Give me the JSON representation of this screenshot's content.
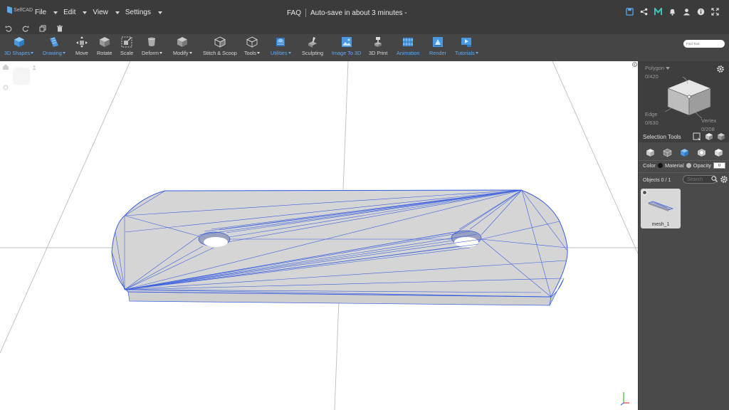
{
  "topbar": {
    "logo_text": "SelfCAD",
    "menu": [
      "File",
      "Edit",
      "View",
      "Settings"
    ],
    "faq": "FAQ",
    "autosave": "Auto-save in about 3 minutes -",
    "icons": [
      "save-icon",
      "share-icon",
      "m-icon",
      "bell-icon",
      "user-icon",
      "info-icon",
      "fullscreen-icon"
    ]
  },
  "subbar": {
    "icons": [
      "undo-icon",
      "redo-icon",
      "copy-icon",
      "trash-icon"
    ]
  },
  "toolbar": {
    "tools": [
      {
        "label": "3D Shapes",
        "caret": true,
        "blue": true
      },
      {
        "label": "Drawing",
        "caret": true,
        "blue": true
      },
      {
        "label": "Move",
        "caret": false,
        "blue": false
      },
      {
        "label": "Rotate",
        "caret": false,
        "blue": false
      },
      {
        "label": "Scale",
        "caret": false,
        "blue": false
      },
      {
        "label": "Deform",
        "caret": true,
        "blue": false
      },
      {
        "label": "Modify",
        "caret": true,
        "blue": false
      },
      {
        "label": "Stitch & Scoop",
        "caret": false,
        "blue": false
      },
      {
        "label": "Tools",
        "caret": true,
        "blue": false
      },
      {
        "label": "Utilities",
        "caret": true,
        "blue": true
      },
      {
        "label": "Sculpting",
        "caret": false,
        "blue": false
      },
      {
        "label": "Image To 3D",
        "caret": false,
        "blue": true
      },
      {
        "label": "3D Print",
        "caret": false,
        "blue": false
      },
      {
        "label": "Animation",
        "caret": false,
        "blue": true
      },
      {
        "label": "Render",
        "caret": false,
        "blue": true
      },
      {
        "label": "Tutorials",
        "caret": true,
        "blue": true
      }
    ],
    "find_placeholder": "Find Tool"
  },
  "panel": {
    "polygon_label": "Polygon",
    "polygon_count": "0/420",
    "edge_label": "Edge",
    "edge_count": "0/630",
    "vertex_label": "Vertex",
    "vertex_count": "0/208",
    "selection_tools": "Selection Tools",
    "color_label": "Color",
    "material_label": "Material",
    "opacity_label": "Opacity",
    "opacity_value": "0",
    "objects_label": "Objects 0 / 1",
    "search_placeholder": "Search",
    "mesh_name": "mesh_1"
  },
  "colors": {
    "accent": "#61a9f0",
    "wire": "#3a5fe0",
    "mesh": "#d4d4d4"
  }
}
